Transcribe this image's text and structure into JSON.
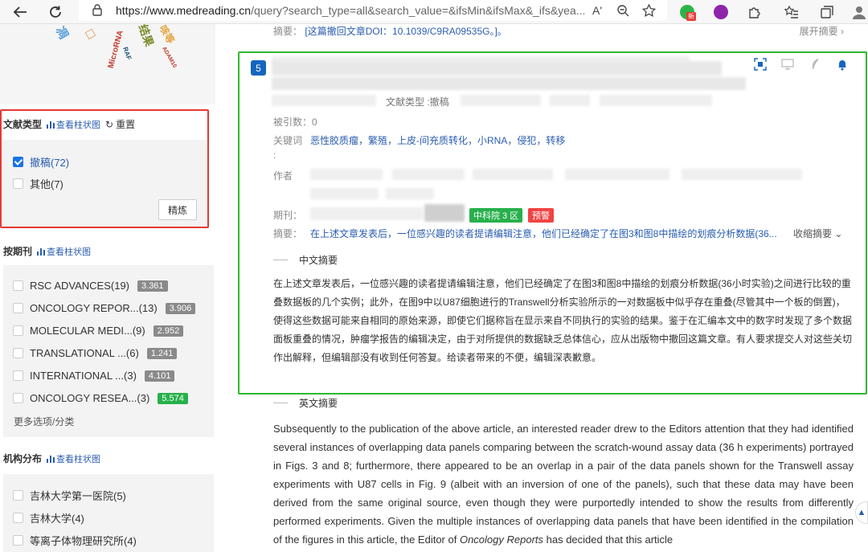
{
  "browser": {
    "url_main": "https://www.medreading.cn",
    "url_rest": "/query?search_type=all&search_value=&ifsMin&ifsMax&_ifs&yea...",
    "reader_label": "Aʹ"
  },
  "cloud_words": [
    "结果",
    "咳等",
    "MicroRNA",
    "RAF",
    "ADAM10",
    "凋"
  ],
  "sidebar": {
    "doc_type": {
      "title": "文献类型",
      "chart_link": "查看柱状图",
      "reset": "重置",
      "options": [
        {
          "label": "撤稿(72)",
          "checked": true
        },
        {
          "label": "其他(7)",
          "checked": false
        }
      ],
      "refine": "精炼"
    },
    "journal": {
      "title": "按期刊",
      "chart_link": "查看柱状图",
      "items": [
        {
          "label": "RSC ADVANCES(19)",
          "if": "3.361",
          "green": false
        },
        {
          "label": "ONCOLOGY REPOR...(13)",
          "if": "3.906",
          "green": false
        },
        {
          "label": "MOLECULAR MEDI...(9)",
          "if": "2.952",
          "green": false
        },
        {
          "label": "TRANSLATIONAL ...(6)",
          "if": "1.241",
          "green": false
        },
        {
          "label": "INTERNATIONAL ...(3)",
          "if": "4.101",
          "green": false
        },
        {
          "label": "ONCOLOGY RESEA...(3)",
          "if": "5.574",
          "green": true
        }
      ],
      "more": "更多选项/分类"
    },
    "institution": {
      "title": "机构分布",
      "chart_link": "查看柱状图",
      "items": [
        "吉林大学第一医院(5)",
        "吉林大学(4)",
        "等离子体物理研究所(4)"
      ]
    }
  },
  "main": {
    "top_abstract_label": "摘要：",
    "top_abstract_value": "[这篇撤回文章DOI：10.1039/C9RA09535G。]。",
    "expand_top": "展开摘要 ›",
    "card": {
      "number": "5",
      "doc_type": "文献类型 :撤稿",
      "cited_label": "被引数：",
      "cited_value": "0",
      "keywords_label": "关键词",
      "keywords_colon": ":",
      "keywords_value": "恶性胶质瘤，繁殖，上皮-间充质转化，小RNA，侵犯，转移",
      "author_label": "作者",
      "journal_label": "期刊：",
      "tag_zone": "中科院 3 区",
      "tag_warn": "预警",
      "abstract_label": "摘要：",
      "abstract_preview": "在上述文章发表后，一位感兴趣的读者提请编辑注意，他们已经确定了在图3和图8中描绘的划痕分析数据(36...",
      "collapse": "收缩摘要 ⌄",
      "cn_title": "中文摘要",
      "cn_abstract": "在上述文章发表后，一位感兴趣的读者提请编辑注意，他们已经确定了在图3和图8中描绘的划痕分析数据(36小时实验)之间进行比较的重叠数据板的几个实例；此外，在图9中以U87细胞进行的Transwell分析实验所示的一对数据板中似乎存在重叠(尽管其中一个板的倒置)，使得这些数据可能来自相同的原始来源，即使它们据称旨在显示来自不同执行的实验的结果。鉴于在汇编本文中的数字时发现了多个数据面板重叠的情况，肿瘤学报告的编辑决定，由于对所提供的数据缺乏总体信心，应从出版物中撤回这篇文章。有人要求提交人对这些关切作出解释，但编辑部没有收到任何答复。给读者带来的不便，编辑深表歉意。"
    },
    "en_title": "英文摘要",
    "en_abstract_pre": "Subsequently to the publication of the above article, an interested reader drew to the Editors attention that they had identified several instances of overlapping data panels comparing between the scratch-wound assay data (36 h experiments) portrayed in Figs. 3 and 8; furthermore, there appeared to be an overlap in a pair of the data panels shown for the Transwell assay experiments with U87 cells in Fig. 9 (albeit with an inversion of one of the panels), such that these data may have been derived from the same original source, even though they were purportedly intended to show the results from differently performed experiments. Given the multiple instances of overlapping data panels that have been identified in the compilation of the figures in this article, the Editor of ",
    "en_abstract_journal": "Oncology Reports",
    "en_abstract_post": " has decided that this article"
  }
}
